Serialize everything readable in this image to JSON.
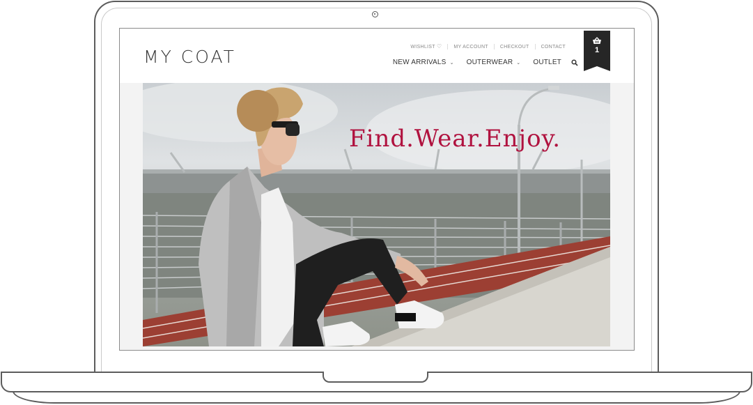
{
  "brand": {
    "logo_text": "MY COAT"
  },
  "utility_nav": {
    "wishlist": "WISHLIST",
    "my_account": "MY ACCOUNT",
    "checkout": "CHECKOUT",
    "contact": "CONTACT"
  },
  "main_nav": {
    "new_arrivals": "NEW ARRIVALS",
    "outerwear": "OUTERWEAR",
    "outlet": "OUTLET"
  },
  "cart": {
    "count": "1"
  },
  "hero": {
    "tagline": "Find.Wear.Enjoy."
  },
  "colors": {
    "accent": "#b0123f",
    "cart_bg": "#262626",
    "track": "#9c3f33"
  },
  "icons": [
    "heart-icon",
    "chevron-down-icon",
    "search-icon",
    "basket-icon",
    "camera-icon"
  ]
}
